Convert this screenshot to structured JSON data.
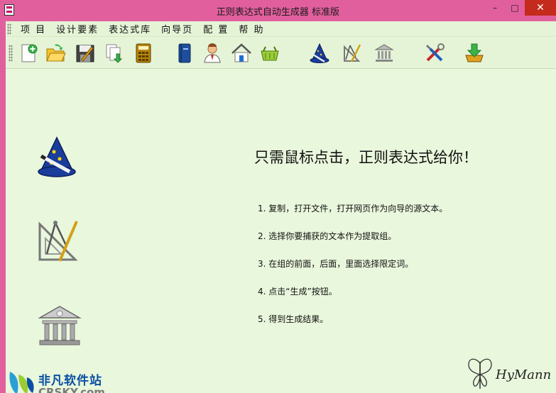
{
  "window": {
    "title": "正则表达式自动生成器 标准版",
    "minimize_glyph": "–",
    "maximize_glyph": "□",
    "close_glyph": "✕",
    "frame_color": "#e25f9e",
    "bg_color": "#e9f7dc"
  },
  "menu": {
    "items": [
      {
        "label": "项  目",
        "name": "project"
      },
      {
        "label": "设计要素",
        "name": "design-elements"
      },
      {
        "label": "表达式库",
        "name": "expression-library"
      },
      {
        "label": "向导页",
        "name": "wizard-page"
      },
      {
        "label": "配  置",
        "name": "config"
      },
      {
        "label": "帮  助",
        "name": "help"
      }
    ]
  },
  "toolbar": {
    "buttons": [
      {
        "icon": "new-document-icon"
      },
      {
        "icon": "open-folder-icon"
      },
      {
        "icon": "save-icon"
      },
      {
        "icon": "copy-pages-icon"
      },
      {
        "icon": "calculator-icon"
      },
      {
        "icon": "book-icon"
      },
      {
        "icon": "user-icon"
      },
      {
        "icon": "home-icon"
      },
      {
        "icon": "basket-icon"
      },
      {
        "icon": "wizard-hat-icon"
      },
      {
        "icon": "drafting-tools-icon"
      },
      {
        "icon": "bank-building-icon"
      },
      {
        "icon": "tools-icon"
      },
      {
        "icon": "download-icon"
      }
    ]
  },
  "main": {
    "headline": "只需鼠标点击，正则表达式给你！",
    "steps": [
      "1. 复制，打开文件，打开网页作为向导的源文本。",
      "2. 选择你要捕获的文本作为提取组。",
      "3. 在组的前面，后面，里面选择限定词。",
      "4. 点击“生成”按钮。",
      "5. 得到生成结果。"
    ],
    "side_icons": [
      "wizard-hat-icon",
      "drafting-tools-icon",
      "bank-building-icon"
    ]
  },
  "watermark": {
    "line1": "非凡软件站",
    "line2": "CRSKY.com"
  },
  "signature": {
    "text": "HyMann"
  }
}
